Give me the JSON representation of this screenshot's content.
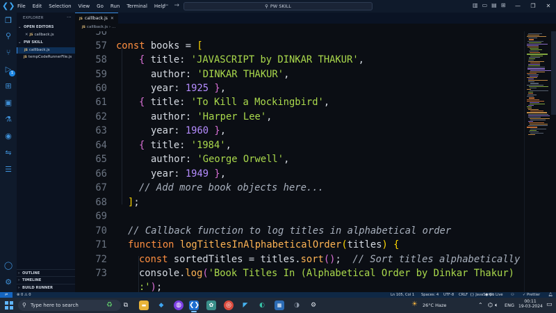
{
  "titlebar": {
    "menu": [
      "File",
      "Edit",
      "Selection",
      "View",
      "Go",
      "Run",
      "Terminal",
      "Help"
    ],
    "search_text": "PW SKILL"
  },
  "sidebar": {
    "title": "EXPLORER",
    "open_editors_label": "OPEN EDITORS",
    "open_editor_file": "callback.js",
    "workspace_label": "PW SKILL",
    "files": [
      "calllback.js",
      "tempCodeRunnerFile.js"
    ],
    "js_badge": "JS"
  },
  "tab": {
    "label": "calllback.js"
  },
  "breadcrumb": {
    "file": "calllback.js",
    "rest": "..."
  },
  "activity_badge": "1",
  "editor": {
    "top_partial_line_number": "56",
    "lines": [
      {
        "n": "57",
        "t": "const books = ["
      },
      {
        "n": "58",
        "t": "{ title: 'JAVASCRIPT by DINKAR THAKUR',"
      },
      {
        "n": "59",
        "t": "author: 'DINKAR THAKUR',"
      },
      {
        "n": "60",
        "t": "year: 1925 },"
      },
      {
        "n": "61",
        "t": "{ title: 'To Kill a Mockingbird',"
      },
      {
        "n": "62",
        "t": "author: 'Harper Lee',"
      },
      {
        "n": "63",
        "t": "year: 1960 },"
      },
      {
        "n": "64",
        "t": "{ title: '1984',"
      },
      {
        "n": "65",
        "t": "author: 'George Orwell',"
      },
      {
        "n": "66",
        "t": "year: 1949 },"
      },
      {
        "n": "67",
        "t": "// Add more book objects here..."
      },
      {
        "n": "68",
        "t": "];"
      },
      {
        "n": "69",
        "t": ""
      },
      {
        "n": "70",
        "t": "// Callback function to log titles in alphabetical order"
      },
      {
        "n": "71",
        "t": "function logTitlesInAlphabeticalOrder(titles) {"
      },
      {
        "n": "72",
        "t": "const sortedTitles = titles.sort();  // Sort titles alphabetically"
      },
      {
        "n": "73",
        "t": "console.log('Book Titles In (Alphabetical Order by Dinkar Thakur)"
      },
      {
        "n": "",
        "t": ":');"
      }
    ]
  },
  "panels": [
    "OUTLINE",
    "TIMELINE",
    "BUILD RUNNER"
  ],
  "statusbar": {
    "errors": "0",
    "warnings": "0",
    "position": "Ln 105, Col 1",
    "spaces": "Spaces: 4",
    "encoding": "UTF-8",
    "eol": "CRLF",
    "language": "JavaScript",
    "golive": "Go Live",
    "prettier": "Prettier"
  },
  "taskbar": {
    "search_placeholder": "Type here to search",
    "weather": "26°C  Haze",
    "language": "ENG",
    "time": "00:11",
    "date": "19-03-2024"
  },
  "colors": {
    "keyword": "#ff8f40",
    "function": "#ffb454",
    "string": "#aad94c",
    "number": "#b58cff",
    "comment": "#a8b0bd",
    "accent": "#3a8ee6"
  }
}
